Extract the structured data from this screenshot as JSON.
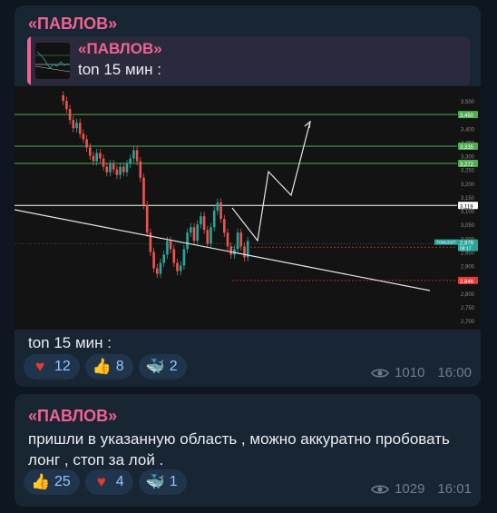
{
  "messages": [
    {
      "sender": "«ПАВЛОВ»",
      "reply": {
        "sender": "«ПАВЛОВ»",
        "text": "ton 15 мин :"
      },
      "caption": "ton 15 мин :",
      "reactions": [
        {
          "icon": "heart-icon",
          "count": "12"
        },
        {
          "icon": "thumbs-up-icon",
          "count": "8"
        },
        {
          "icon": "whale-icon",
          "count": "2"
        }
      ],
      "views": "1010",
      "time": "16:00"
    },
    {
      "sender": "«ПАВЛОВ»",
      "text": "пришли в указанную область , можно аккуратно пробовать лонг , стоп за лой .",
      "reactions": [
        {
          "icon": "thumbs-up-icon",
          "count": "25"
        },
        {
          "icon": "heart-icon",
          "count": "4"
        },
        {
          "icon": "whale-icon",
          "count": "1"
        }
      ],
      "views": "1029",
      "time": "16:01"
    }
  ],
  "chart_data": {
    "type": "candlestick",
    "price_axis_labels": [
      "3,500",
      "3,450",
      "3,400",
      "3,350",
      "3,300",
      "3,250",
      "3,200",
      "3,150",
      "3,100",
      "3,050",
      "3,000",
      "2,950",
      "2,900",
      "2,850",
      "2,800",
      "2,750",
      "2,700"
    ],
    "ylim": [
      2.7,
      3.52
    ],
    "levels": [
      {
        "label": "3,450",
        "value": 3.45,
        "color": "#4caf50"
      },
      {
        "label": "3,335",
        "value": 3.335,
        "color": "#4caf50"
      },
      {
        "label": "3,272",
        "value": 3.272,
        "color": "#4caf50"
      },
      {
        "label": "3,119",
        "value": 3.119,
        "color": "#ffffff"
      },
      {
        "label": "2,967",
        "value": 2.967,
        "color": "#e53935"
      },
      {
        "label": "2,846",
        "value": 2.846,
        "color": "#e53935"
      }
    ],
    "current_price": {
      "symbol": "TONUSDT",
      "label": "2,979",
      "countdown": "08:17",
      "value": 2.979
    },
    "closes": [
      3.52,
      3.5,
      3.47,
      3.43,
      3.4,
      3.42,
      3.38,
      3.36,
      3.33,
      3.3,
      3.28,
      3.31,
      3.29,
      3.26,
      3.24,
      3.27,
      3.25,
      3.23,
      3.26,
      3.24,
      3.27,
      3.29,
      3.32,
      3.28,
      3.22,
      3.12,
      3.02,
      2.95,
      2.89,
      2.87,
      2.91,
      2.94,
      2.99,
      2.96,
      2.91,
      2.88,
      2.9,
      2.96,
      3.02,
      3.04,
      2.99,
      3.05,
      3.08,
      3.03,
      2.98,
      3.04,
      3.1,
      3.13,
      3.07,
      3.02,
      2.97,
      2.94,
      2.96,
      3.02,
      2.97,
      2.93,
      2.99
    ]
  }
}
